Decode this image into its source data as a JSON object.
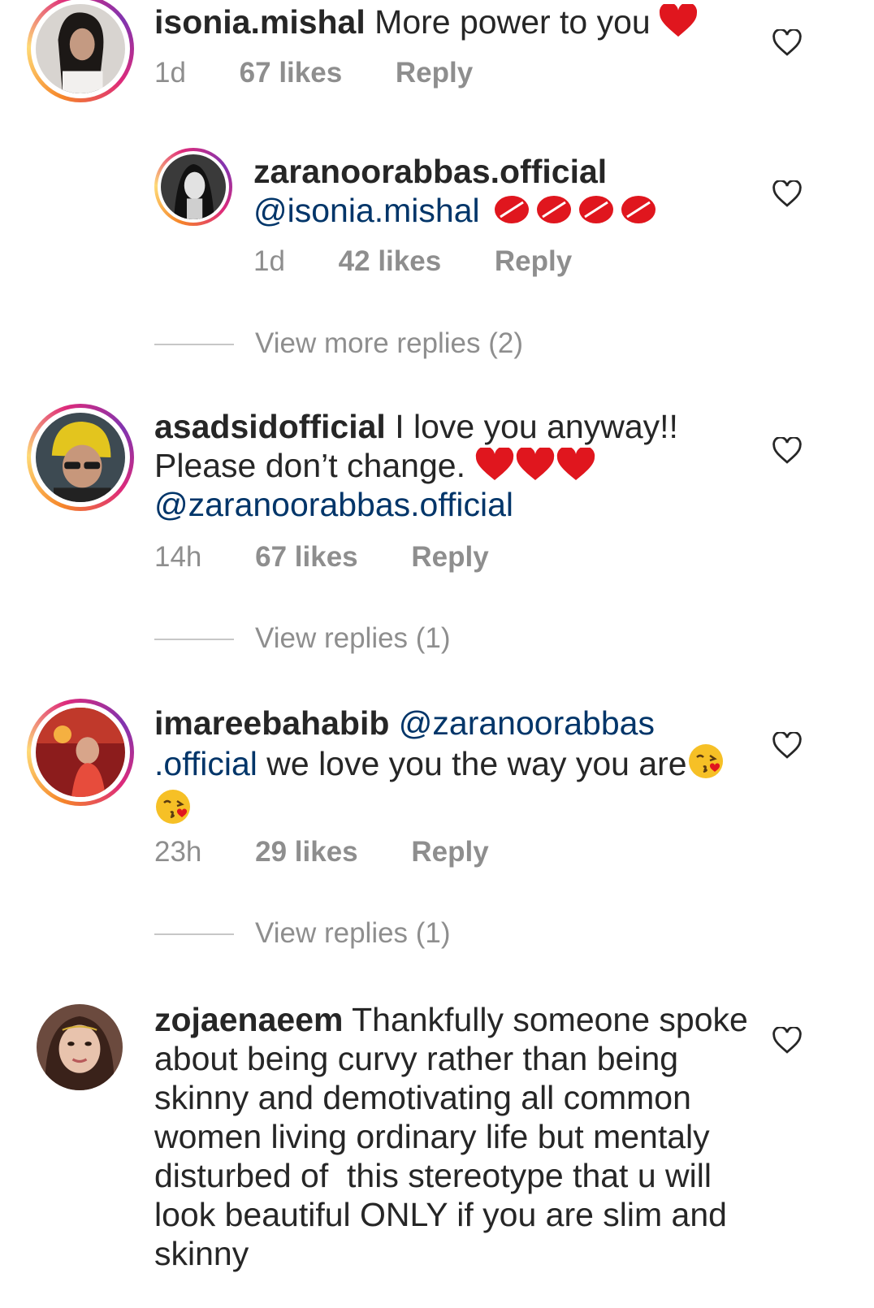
{
  "comments": [
    {
      "username": "isonia.mishal",
      "text": "More power to you",
      "time": "1d",
      "likes": "67 likes",
      "reply": "Reply"
    },
    {
      "username": "zaranoorabbas.official",
      "mention": "@isonia.mishal",
      "time": "1d",
      "likes": "42 likes",
      "reply": "Reply"
    },
    {
      "username": "asadsidofficial",
      "text_line1": "I love you anyway!!",
      "text_line2": "Please don’t change.",
      "mention": "@zaranoorabbas.official",
      "time": "14h",
      "likes": "67 likes",
      "reply": "Reply"
    },
    {
      "username": "imareebahabib",
      "mention_part1": "@zaranoorabbas",
      "mention_part2": ".official",
      "text": " we love you the way you are",
      "time": "23h",
      "likes": "29 likes",
      "reply": "Reply"
    },
    {
      "username": "zojaenaeem",
      "lines": [
        "Thankfully someone spoke",
        "about being curvy rather than being",
        "skinny and demotivating all common",
        "women living ordinary life but mentaly",
        "disturbed of  this stereotype that u will",
        "look beautiful ONLY if you are slim and",
        "skinny"
      ]
    }
  ],
  "view_replies": [
    "View more replies (2)",
    "View replies (1)",
    "View replies (1)"
  ],
  "colors": {
    "text": "#262626",
    "meta": "#8e8e8e",
    "mention": "#003569",
    "heart_red": "#e0161e"
  },
  "icons": {
    "like": "heart-outline-icon",
    "heart": "red-heart-emoji",
    "kiss": "kiss-mark-emoji",
    "face": "face-blowing-kiss-emoji"
  }
}
